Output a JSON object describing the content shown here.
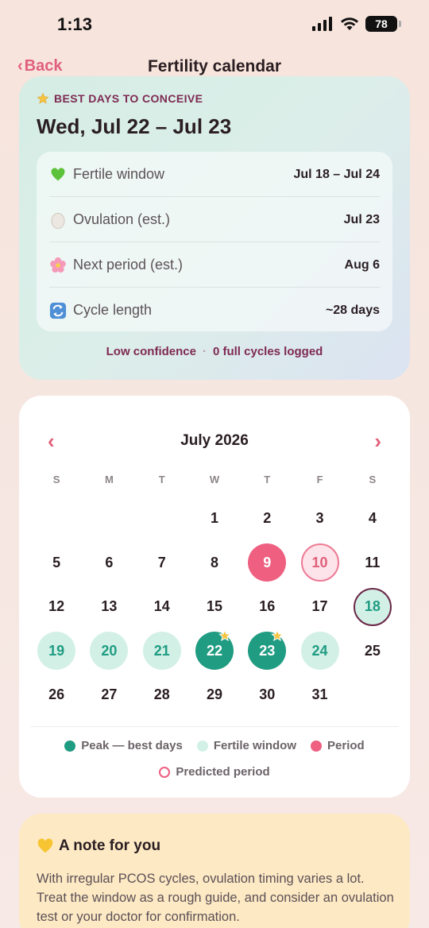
{
  "status_bar": {
    "time": "1:13",
    "battery": "78"
  },
  "nav": {
    "back_label": "Back",
    "back_chevron": "‹",
    "title": "Fertility calendar"
  },
  "summary": {
    "eyebrow": "BEST DAYS TO CONCEIVE",
    "headline": "Wed, Jul 22 – Jul 23",
    "rows": [
      {
        "icon": "green-heart-icon",
        "label": "Fertile window",
        "value": "Jul 18 – Jul 24"
      },
      {
        "icon": "egg-icon",
        "label": "Ovulation (est.)",
        "value": "Jul 23"
      },
      {
        "icon": "flower-icon",
        "label": "Next period (est.)",
        "value": "Aug 6"
      },
      {
        "icon": "cycle-icon",
        "label": "Cycle length",
        "value": "~28 days"
      }
    ],
    "confidence": "Low confidence",
    "cycles_logged": "0 full cycles logged"
  },
  "calendar": {
    "month": "July 2026",
    "prev": "‹",
    "next": "›",
    "weekdays": [
      "S",
      "M",
      "T",
      "W",
      "T",
      "F",
      "S"
    ],
    "leading_blanks": 3,
    "days": [
      {
        "d": "1",
        "s": ""
      },
      {
        "d": "2",
        "s": ""
      },
      {
        "d": "3",
        "s": ""
      },
      {
        "d": "4",
        "s": ""
      },
      {
        "d": "5",
        "s": ""
      },
      {
        "d": "6",
        "s": ""
      },
      {
        "d": "7",
        "s": ""
      },
      {
        "d": "8",
        "s": ""
      },
      {
        "d": "9",
        "s": "period"
      },
      {
        "d": "10",
        "s": "predicted"
      },
      {
        "d": "11",
        "s": ""
      },
      {
        "d": "12",
        "s": ""
      },
      {
        "d": "13",
        "s": ""
      },
      {
        "d": "14",
        "s": ""
      },
      {
        "d": "15",
        "s": ""
      },
      {
        "d": "16",
        "s": ""
      },
      {
        "d": "17",
        "s": ""
      },
      {
        "d": "18",
        "s": "fertile today"
      },
      {
        "d": "19",
        "s": "fertile"
      },
      {
        "d": "20",
        "s": "fertile"
      },
      {
        "d": "21",
        "s": "fertile"
      },
      {
        "d": "22",
        "s": "peak star"
      },
      {
        "d": "23",
        "s": "peak star"
      },
      {
        "d": "24",
        "s": "fertile"
      },
      {
        "d": "25",
        "s": ""
      },
      {
        "d": "26",
        "s": ""
      },
      {
        "d": "27",
        "s": ""
      },
      {
        "d": "28",
        "s": ""
      },
      {
        "d": "29",
        "s": ""
      },
      {
        "d": "30",
        "s": ""
      },
      {
        "d": "31",
        "s": ""
      }
    ],
    "legend": {
      "peak": "Peak — best days",
      "fertile": "Fertile window",
      "period": "Period",
      "predicted": "Predicted period"
    }
  },
  "note": {
    "title": "A note for you",
    "body": "With irregular PCOS cycles, ovulation timing varies a lot. Treat the window as a rough guide, and consider an ovulation test or your doctor for confirmation."
  },
  "colors": {
    "accent": "#e0607a",
    "peak": "#1f9c82",
    "fertile": "#d3f0e7",
    "period": "#ee5f80",
    "brand_text": "#7e2a52"
  }
}
